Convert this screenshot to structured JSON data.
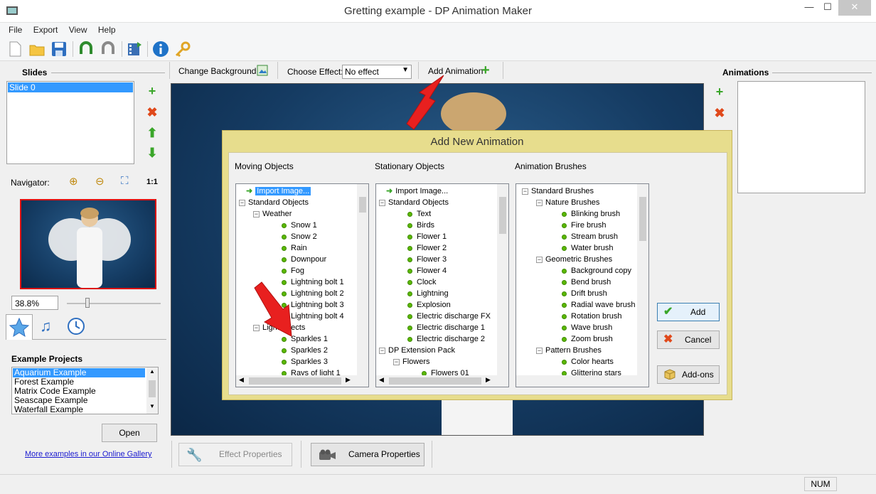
{
  "window": {
    "title": "Gretting example - DP Animation Maker",
    "minimize": "—",
    "maximize": "☐",
    "close": "✕"
  },
  "menu": [
    "File",
    "Export",
    "View",
    "Help"
  ],
  "toolbar_icons": [
    "new-icon",
    "open-folder-icon",
    "save-icon",
    "undo-icon",
    "redo-icon",
    "export-video-icon",
    "info-icon",
    "key-icon"
  ],
  "slides": {
    "title": "Slides",
    "items": [
      "Slide 0"
    ]
  },
  "navigator": {
    "label": "Navigator:",
    "one_to_one": "1:1",
    "zoom": "38.8%"
  },
  "example_projects": {
    "title": "Example Projects",
    "items": [
      "Aquarium Example",
      "Forest Example",
      "Matrix Code Example",
      "Seascape Example",
      "Waterfall Example"
    ],
    "open_label": "Open",
    "gallery_link": "More examples in our Online Gallery"
  },
  "effect_bar": {
    "change_background": "Change Background",
    "choose_effect_label": "Choose Effect:",
    "choose_effect_value": "No effect",
    "add_animation": "Add Animation"
  },
  "animations": {
    "title": "Animations"
  },
  "bottom_buttons": {
    "effect_properties": "Effect Properties",
    "camera_properties": "Camera Properties"
  },
  "dialog": {
    "title": "Add New Animation",
    "columns": [
      "Moving Objects",
      "Stationary Objects",
      "Animation Brushes"
    ],
    "moving": [
      "Import Image...",
      "Standard Objects",
      "Weather",
      "Snow 1",
      "Snow 2",
      "Rain",
      "Downpour",
      "Fog",
      "Lightning bolt 1",
      "Lightning bolt 2",
      "Lightning bolt 3",
      "Lightning bolt 4",
      "Light Effects",
      "Sparkles 1",
      "Sparkles 2",
      "Sparkles 3",
      "Rays of light 1"
    ],
    "stationary": [
      "Import Image...",
      "Standard Objects",
      "Text",
      "Birds",
      "Flower 1",
      "Flower 2",
      "Flower 3",
      "Flower 4",
      "Clock",
      "Lightning",
      "Explosion",
      "Electric discharge FX",
      "Electric discharge 1",
      "Electric discharge 2",
      "DP Extension Pack",
      "Flowers",
      "Flowers 01"
    ],
    "brushes": [
      "Standard Brushes",
      "Nature Brushes",
      "Blinking brush",
      "Fire brush",
      "Stream brush",
      "Water brush",
      "Geometric Brushes",
      "Background copy",
      "Bend brush",
      "Drift brush",
      "Radial wave brush",
      "Rotation brush",
      "Wave brush",
      "Zoom brush",
      "Pattern Brushes",
      "Color hearts",
      "Glittering stars"
    ],
    "add_label": "Add",
    "cancel_label": "Cancel",
    "addons_label": "Add-ons"
  },
  "status": {
    "num": "NUM"
  },
  "colors": {
    "accent_blue": "#3399ff",
    "dialog_gold": "#e7dd8d",
    "canvas_blue": "#153b62",
    "arrow_red": "#e8201f"
  }
}
